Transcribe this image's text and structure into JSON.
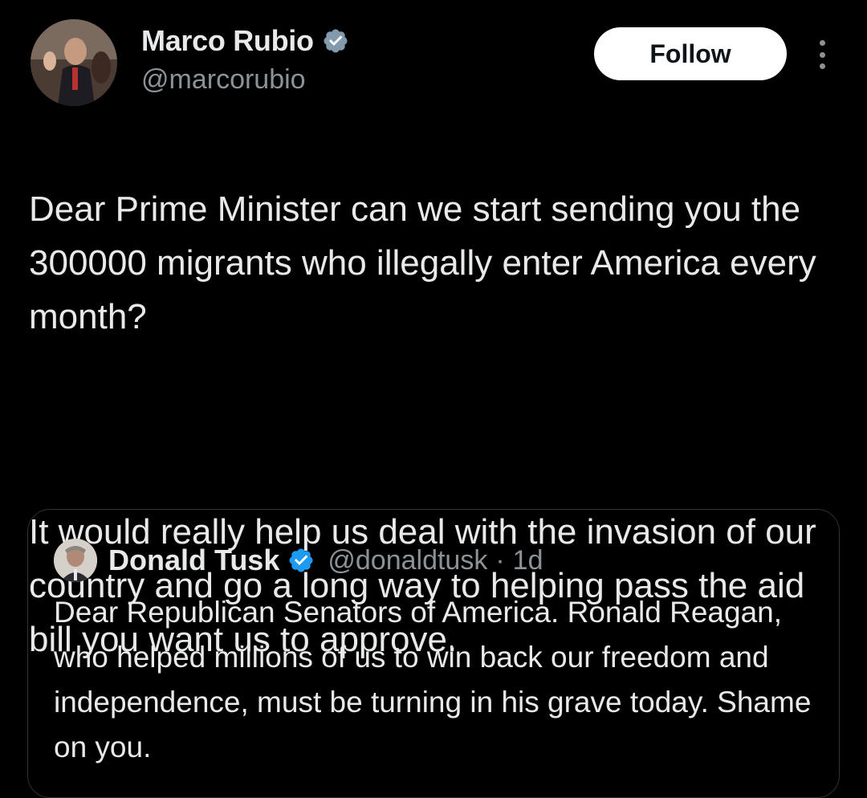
{
  "tweet": {
    "author": {
      "name": "Marco Rubio",
      "handle": "@marcorubio",
      "verified": true
    },
    "follow_label": "Follow",
    "paragraphs": [
      "Dear Prime Minister can we start sending you the 300000 migrants who illegally enter America every month?",
      "It would really help us deal with the invasion of our country and go a long way to helping pass the aid bill you want us to approve."
    ]
  },
  "quote": {
    "author": {
      "name": "Donald Tusk",
      "handle": "@donaldtusk",
      "verified": true
    },
    "separator": "·",
    "time": "1d",
    "text": "Dear Republican Senators of America. Ronald Reagan, who helped millions of us to win back our freedom and independence, must be turning in his grave today. Shame on you."
  },
  "colors": {
    "background": "#000000",
    "text_primary": "#e7e9ea",
    "text_secondary": "#8b9298",
    "verified_badge": "#1d9bf0",
    "verified_badge_gray": "#829aab",
    "follow_button_bg": "#ffffff",
    "card_border": "#2f3336"
  },
  "icons": {
    "author_verified": "verified-gray-badge-icon",
    "quote_verified": "verified-blue-badge-icon",
    "more": "more-options-icon"
  }
}
